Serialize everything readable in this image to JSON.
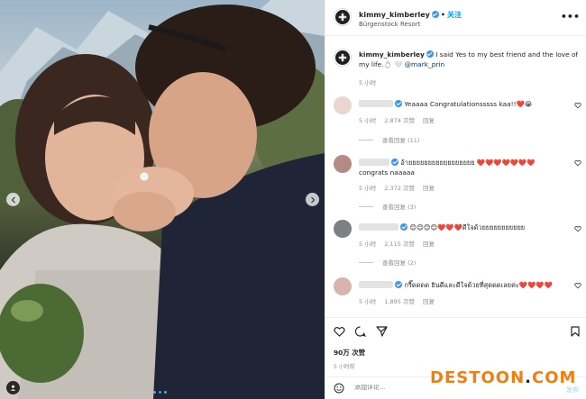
{
  "post": {
    "username": "kimmy_kimberley",
    "follow_label": "关注",
    "location": "Bürgenstock Resort",
    "more_label": "•••",
    "caption_username": "kimmy_kimberley",
    "caption_text": "I said Yes to my best friend and the love of my life.💍 🤍",
    "caption_mention": "@mark_prin",
    "caption_time": "5 小时",
    "likes": "90万 次赞",
    "post_time": "5 小时前",
    "add_comment_placeholder": "添加评论…",
    "post_button": "发布",
    "carousel_index": 2,
    "carousel_total": 3
  },
  "comments": [
    {
      "text": "Yeaaaa Congratulationsssss kaa!!❤️😭",
      "time": "5 小时",
      "likes": "2,874 次赞",
      "reply": "回复",
      "view_replies": "查看回复 (11)",
      "avatar_color": "#e8d6cf"
    },
    {
      "text": "อ้ายยยยยยยยยยยยยยยยย ❤️❤️❤️❤️❤️❤️❤️",
      "text2": "congrats naaaaa",
      "time": "5 小时",
      "likes": "2,372 次赞",
      "reply": "回复",
      "view_replies": "查看回复 (3)",
      "avatar_color": "#b48a84"
    },
    {
      "text": "😊😊😊😊❤️❤️❤️ดีใจด้วยยยยยยยยยยย",
      "time": "5 小时",
      "likes": "2,115 次赞",
      "reply": "回复",
      "view_replies": "查看回复 (2)",
      "avatar_color": "#7d7f82"
    },
    {
      "text": "กรี๊ดดดด ยินดีและดีใจด้วยที่สุดดดเลยค่ะ❤️❤️❤️❤️",
      "time": "5 小时",
      "likes": "1,895 次赞",
      "reply": "回复",
      "avatar_color": "#d9b3ad"
    }
  ],
  "icons": {
    "header_avatar": "flower-avatar-icon",
    "like": "heart-icon",
    "comment": "speech-bubble-icon",
    "share": "paper-plane-icon",
    "save": "bookmark-icon",
    "emoji": "smiley-icon",
    "prev": "chevron-left-icon",
    "next": "chevron-right-icon",
    "tag": "user-tag-icon"
  },
  "watermark": {
    "main": "DESTOON",
    "dot": ".",
    "suffix": "COM"
  },
  "colors": {
    "accent_blue": "#0095f6",
    "verified_blue": "#3897f0",
    "heart_red": "#ed1c24",
    "watermark_orange": "#f07f12"
  }
}
